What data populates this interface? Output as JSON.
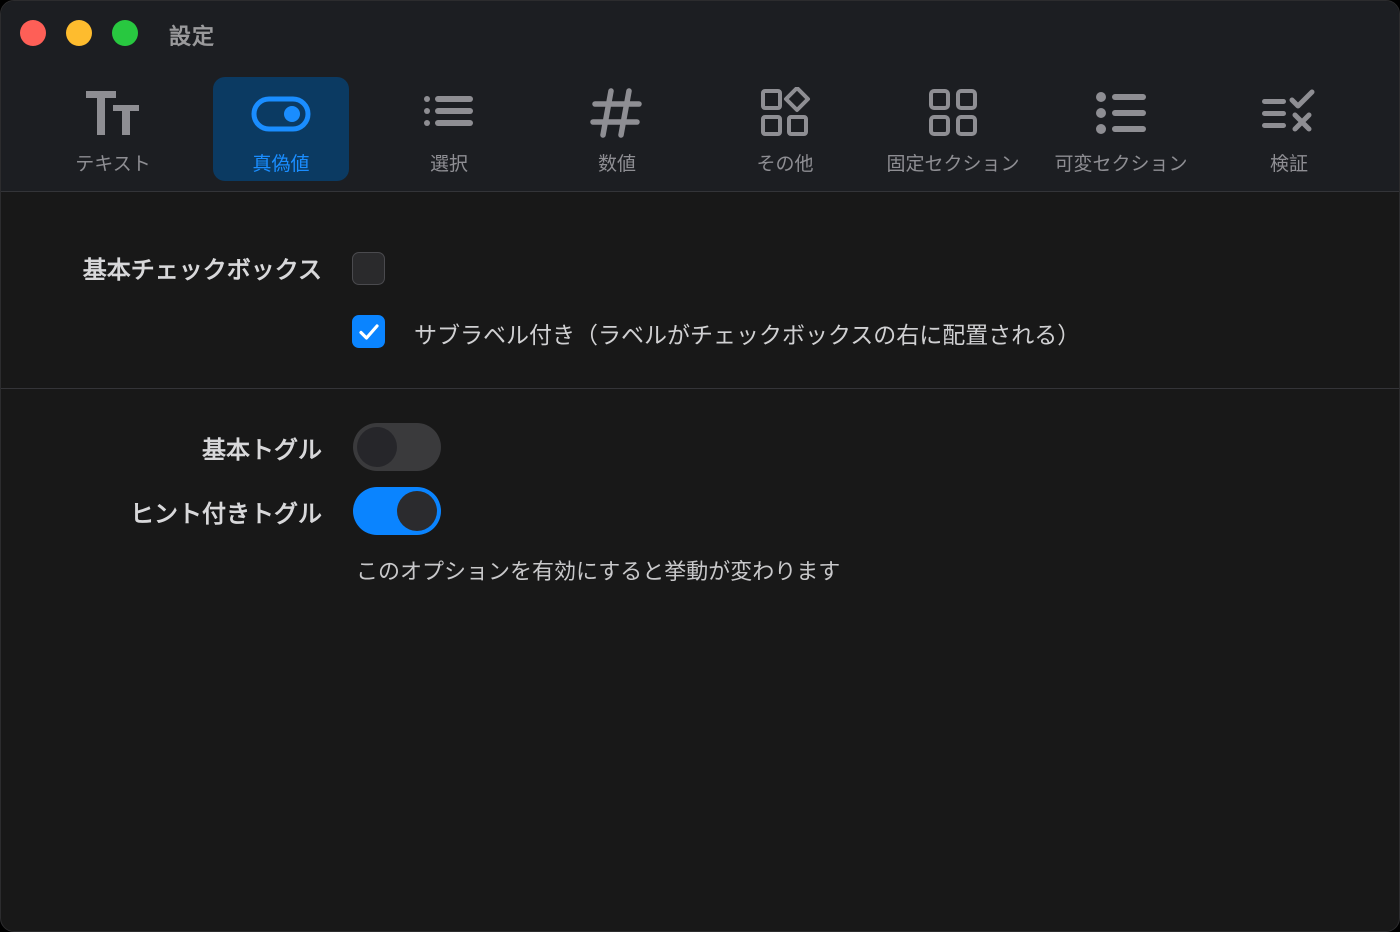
{
  "window": {
    "title": "設定",
    "controls": {
      "close_color": "#fe5f57",
      "minimize_color": "#febc2e",
      "maximize_color": "#28c840"
    }
  },
  "toolbar": {
    "tabs": [
      {
        "label": "テキスト",
        "icon": "text-format-icon",
        "active": false
      },
      {
        "label": "真偽値",
        "icon": "toggle-icon",
        "active": true
      },
      {
        "label": "選択",
        "icon": "list-icon",
        "active": false
      },
      {
        "label": "数値",
        "icon": "number-sign-icon",
        "active": false
      },
      {
        "label": "その他",
        "icon": "widgets-icon",
        "active": false
      },
      {
        "label": "固定セクション",
        "icon": "grid-icon",
        "active": false
      },
      {
        "label": "可変セクション",
        "icon": "bulleted-list-icon",
        "active": false
      },
      {
        "label": "検証",
        "icon": "checklist-icon",
        "active": false
      }
    ]
  },
  "checkboxes": {
    "basic": {
      "label": "基本チェックボックス",
      "checked": false
    },
    "with_sublabel": {
      "sublabel": "サブラベル付き（ラベルがチェックボックスの右に配置される）",
      "checked": true
    }
  },
  "toggles": {
    "basic": {
      "label": "基本トグル",
      "on": false
    },
    "with_hint": {
      "label": "ヒント付きトグル",
      "on": true,
      "hint": "このオプションを有効にすると挙動が変わります"
    }
  },
  "colors": {
    "accent": "#0a84ff",
    "active_tab_bg": "#0b3a62",
    "active_tab_text": "#1a8dff"
  }
}
